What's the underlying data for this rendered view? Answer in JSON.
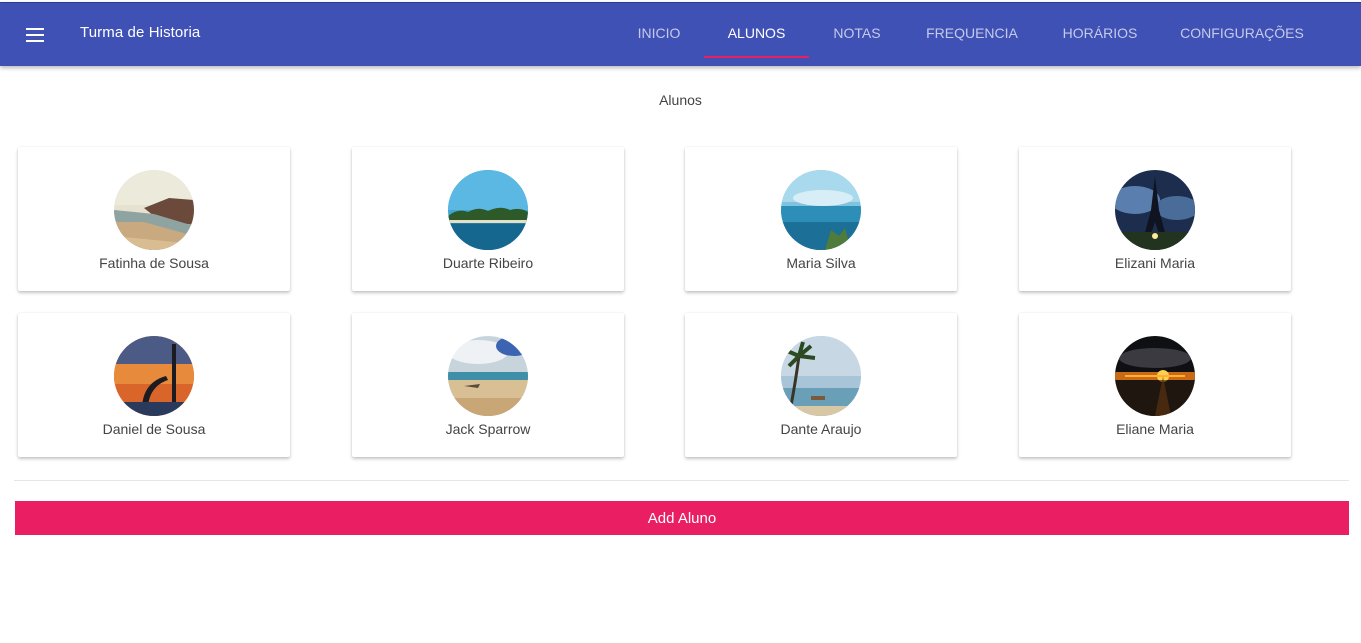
{
  "header": {
    "title": "Turma de Historia",
    "menu_icon": "hamburger-menu-icon",
    "tabs": [
      {
        "label": "INICIO",
        "active": false
      },
      {
        "label": "ALUNOS",
        "active": true
      },
      {
        "label": "NOTAS",
        "active": false
      },
      {
        "label": "FREQUENCIA",
        "active": false
      },
      {
        "label": "HORÁRIOS",
        "active": false
      },
      {
        "label": "CONFIGURAÇÕES",
        "active": false
      }
    ]
  },
  "main": {
    "section_title": "Alunos",
    "students": [
      {
        "name": "Fatinha de Sousa",
        "photo": "beach-cliff-photo"
      },
      {
        "name": "Duarte Ribeiro",
        "photo": "tropical-island-photo"
      },
      {
        "name": "Maria Silva",
        "photo": "ocean-horizon-photo"
      },
      {
        "name": "Elizani Maria",
        "photo": "eiffel-tower-photo"
      },
      {
        "name": "Daniel de Sousa",
        "photo": "sunset-monument-photo"
      },
      {
        "name": "Jack Sparrow",
        "photo": "sandy-beach-clouds-photo"
      },
      {
        "name": "Dante Araujo",
        "photo": "palm-beach-photo"
      },
      {
        "name": "Eliane Maria",
        "photo": "sea-sunset-photo"
      }
    ],
    "add_button_label": "Add Aluno"
  },
  "colors": {
    "primary": "#3f51b5",
    "accent": "#e91e63"
  }
}
